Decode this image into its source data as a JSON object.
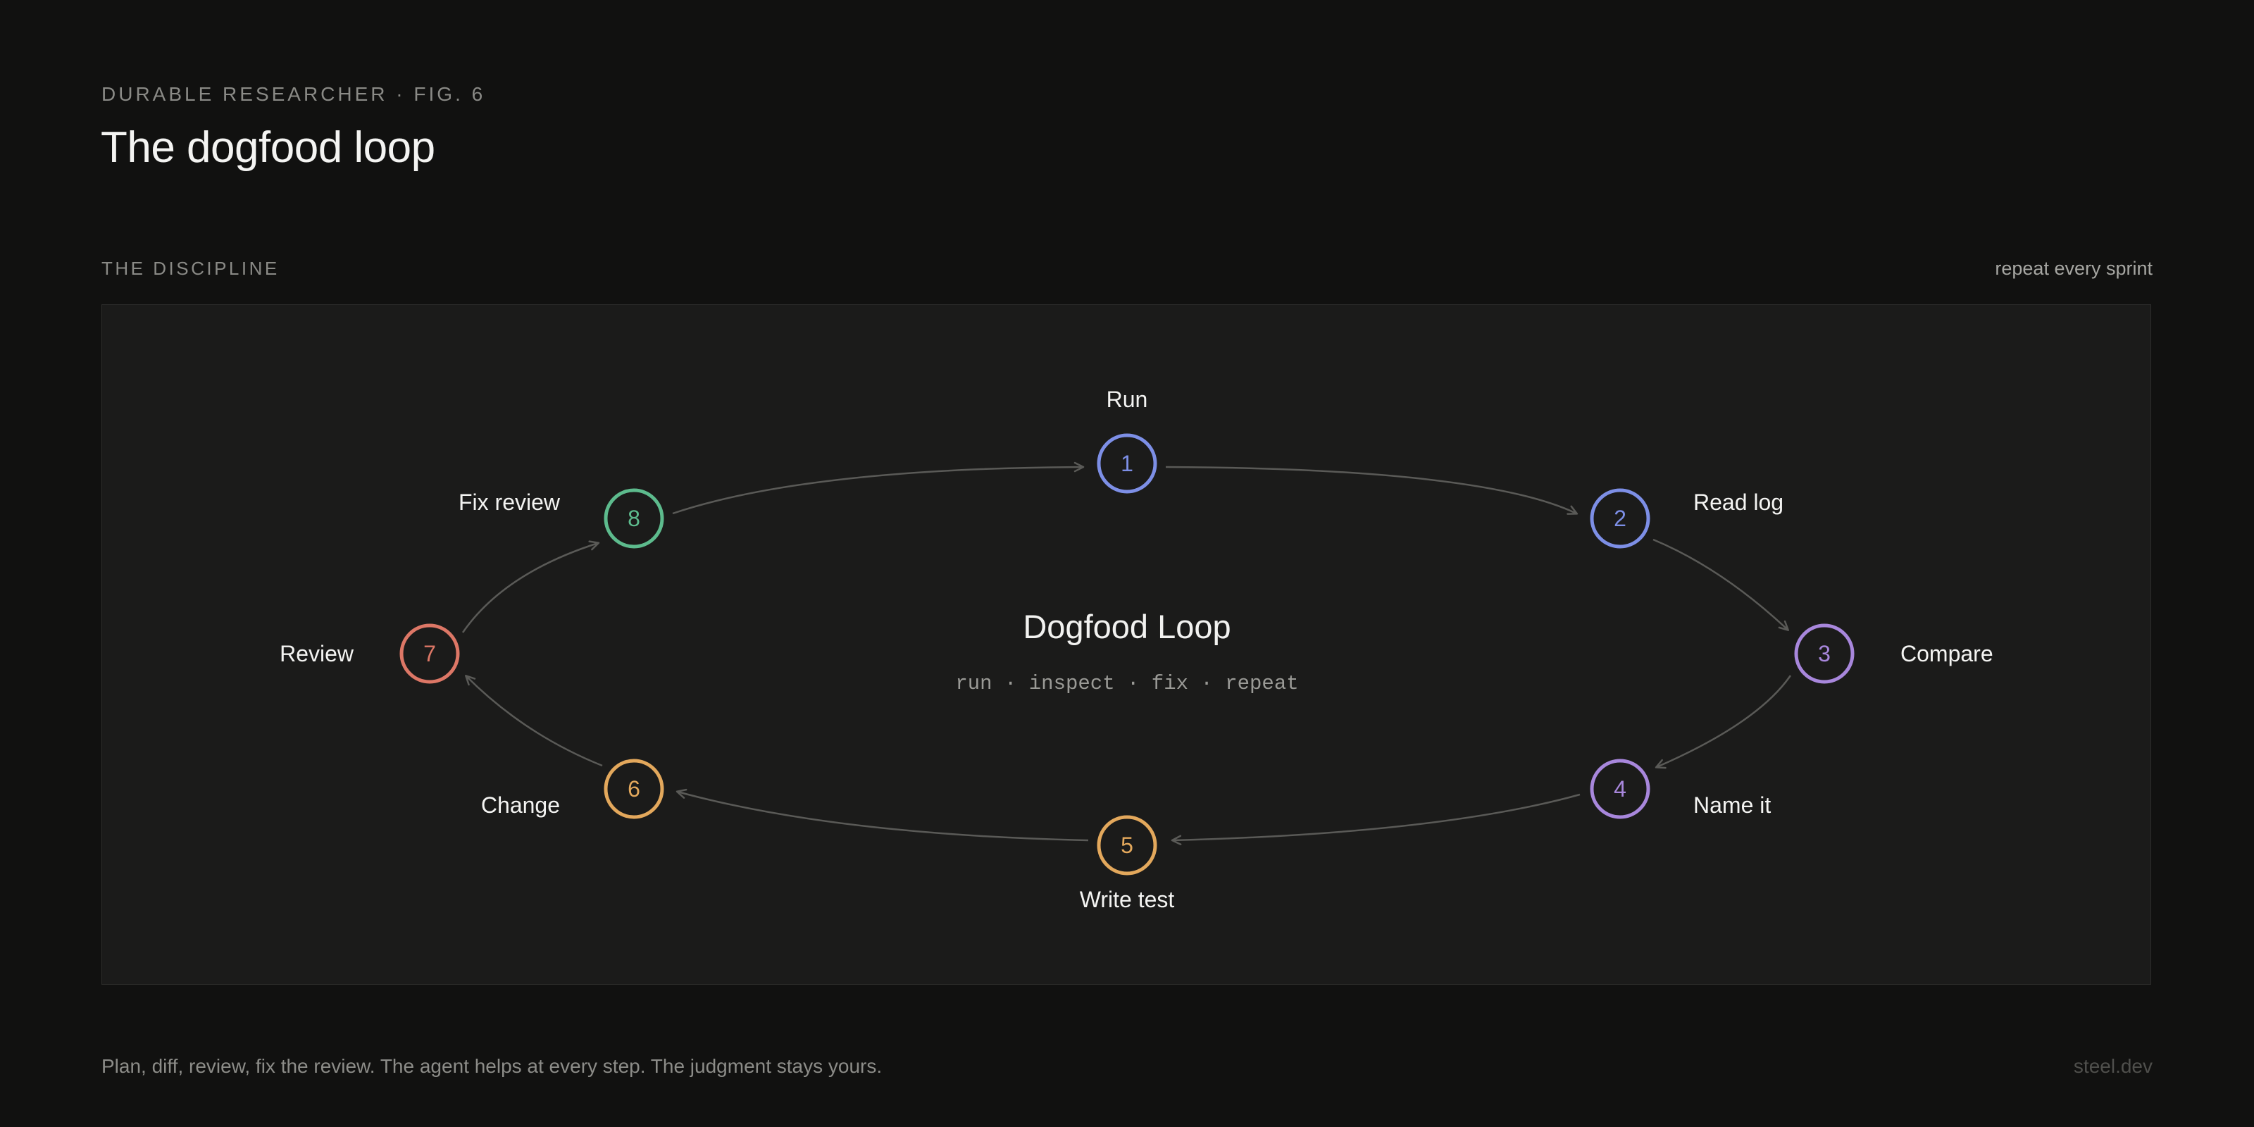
{
  "header": {
    "eyebrow": "DURABLE RESEARCHER · FIG. 6",
    "title": "The dogfood loop"
  },
  "section": {
    "label": "THE DISCIPLINE",
    "note": "repeat every sprint"
  },
  "diagram": {
    "center_title": "Dogfood Loop",
    "center_subtitle": "run · inspect · fix · repeat",
    "colors": {
      "blue": "#7d8fe6",
      "purple": "#a887dc",
      "amber": "#e3a85c",
      "red": "#dd7766",
      "green": "#5dbb8d",
      "edge": "#5a5a57"
    },
    "steps": [
      {
        "num": "1",
        "label": "Run",
        "color": "blue"
      },
      {
        "num": "2",
        "label": "Read log",
        "color": "blue"
      },
      {
        "num": "3",
        "label": "Compare",
        "color": "purple"
      },
      {
        "num": "4",
        "label": "Name it",
        "color": "purple"
      },
      {
        "num": "5",
        "label": "Write test",
        "color": "amber"
      },
      {
        "num": "6",
        "label": "Change",
        "color": "amber"
      },
      {
        "num": "7",
        "label": "Review",
        "color": "red"
      },
      {
        "num": "8",
        "label": "Fix review",
        "color": "green"
      }
    ]
  },
  "footer": {
    "caption": "Plan, diff, review, fix the review. The agent helps at every step. The judgment stays yours.",
    "brand": "steel.dev"
  }
}
